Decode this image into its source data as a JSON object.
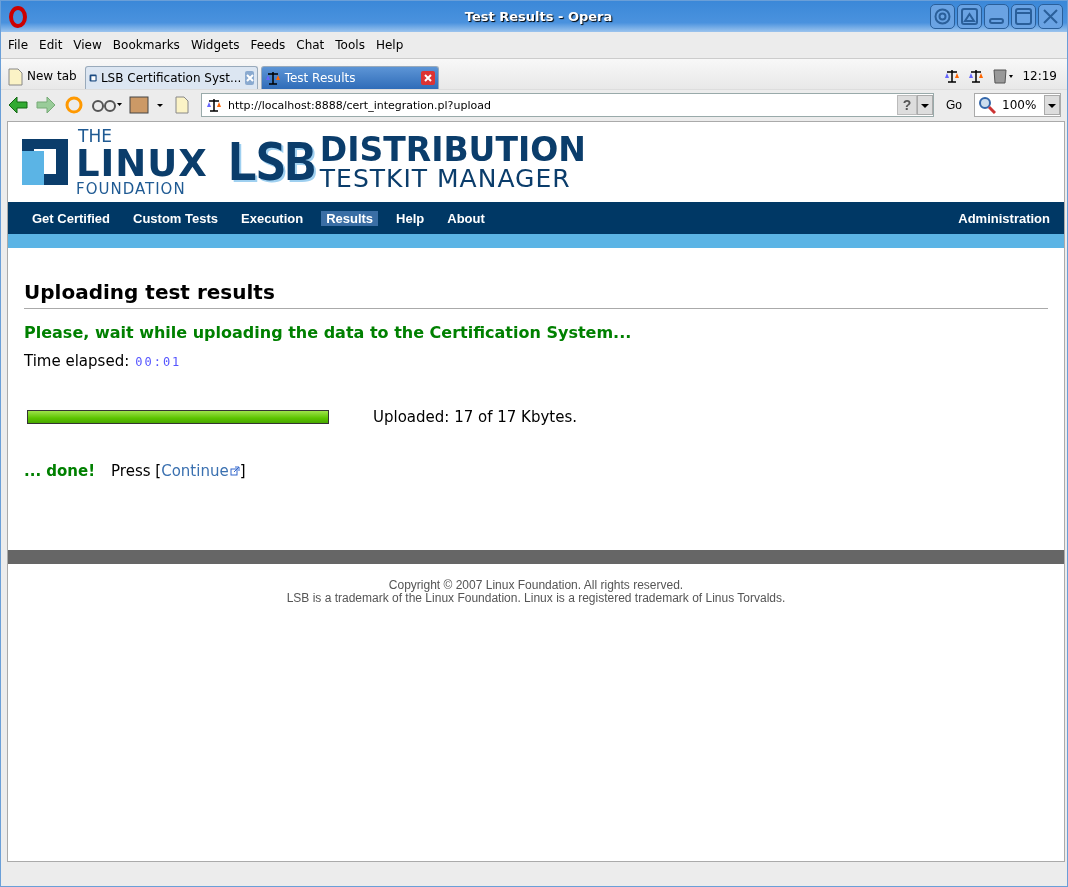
{
  "window": {
    "title": "Test Results - Opera"
  },
  "menu": [
    "File",
    "Edit",
    "View",
    "Bookmarks",
    "Widgets",
    "Feeds",
    "Chat",
    "Tools",
    "Help"
  ],
  "new_tab": "New tab",
  "tabs": [
    {
      "label": "LSB Certification Syst...",
      "selected": false
    },
    {
      "label": "Test Results",
      "selected": true
    }
  ],
  "clock": "12:19",
  "address": {
    "value": "http://localhost:8888/cert_integration.pl?upload"
  },
  "search_engine": "?",
  "go": "Go",
  "zoom": "100%",
  "logo": {
    "the": "THE",
    "linux": "LINUX",
    "foundation": "FOUNDATION",
    "lsb": "LSB",
    "distribution": "DISTRIBUTION",
    "testkit": "TESTKIT MANAGER"
  },
  "nav": [
    {
      "label": "Get Certified",
      "selected": false
    },
    {
      "label": "Custom Tests",
      "selected": false
    },
    {
      "label": "Execution",
      "selected": false
    },
    {
      "label": "Results",
      "selected": true
    },
    {
      "label": "Help",
      "selected": false
    },
    {
      "label": "About",
      "selected": false
    }
  ],
  "nav_right": "Administration",
  "heading": "Uploading test results",
  "status": "Please, wait while uploading the data to the Certification System...",
  "time_label": "Time elapsed:",
  "time_value": "00:01",
  "progress": {
    "level": 1
  },
  "uploaded": "Uploaded: 17 of 17 Kbytes.",
  "done": "... done!",
  "press": "Press [",
  "link": "Continue",
  "close_bracket": "]",
  "footer": [
    "Copyright © 2007 Linux Foundation. All rights reserved.",
    "LSB is a trademark of the Linux Foundation. Linux is a registered trademark of Linus Torvalds."
  ]
}
